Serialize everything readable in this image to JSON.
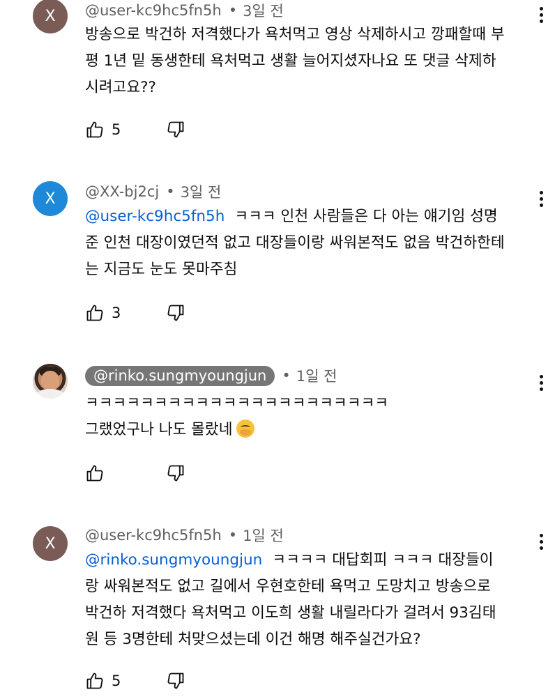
{
  "comments": [
    {
      "avatar_letter": "X",
      "author": "@user-kc9hc5fn5h",
      "time": "3일 전",
      "mention": "",
      "text": "방송으로 박건하 저격했다가 욕처먹고 영상 삭제하시고 깡패할때 부\n평 1년 밑 동생한테 욕처먹고 생활 늘어지셨자나요 또 댓글 삭제하\n시려고요??",
      "likes": "5"
    },
    {
      "avatar_letter": "X",
      "author": "@XX-bj2cj",
      "time": "3일 전",
      "mention": "@user-kc9hc5fn5h",
      "text": "ㅋㅋㅋ 인천 사람들은 다 아는 얘기임 성명\n준 인천 대장이였던적 없고 대장들이랑 싸워본적도 없음 박건하한테\n는 지금도 눈도 못마주침",
      "likes": "3"
    },
    {
      "author": "@rinko.sungmyoungjun",
      "time": "1일 전",
      "mention": "",
      "text": "ㅋㅋㅋㅋㅋㅋㅋㅋㅋㅋㅋㅋㅋㅋㅋㅋㅋㅋㅋㅋㅋㅋ\n그랬었구나 나도 몰랐네",
      "likes": ""
    },
    {
      "avatar_letter": "X",
      "author": "@user-kc9hc5fn5h",
      "time": "1일 전",
      "mention": "@rinko.sungmyoungjun",
      "text": "ㅋㅋㅋㅋ 대답회피 ㅋㅋㅋ 대장들이\n랑 싸워본적도 없고 길에서 우현호한테 욕먹고 도망치고 방송으로\n박건하 저격했다 욕처먹고 이도희 생활 내릴라다가 걸려서 93김태\n원 등 3명한테 처맞으셨는데 이건 해명 해주실건가요?",
      "likes": "5"
    }
  ],
  "separator": "•",
  "icons": {
    "like": "thumbs-up-icon",
    "dislike": "thumbs-down-icon",
    "more": "more-vert-icon",
    "emoji": "smiling-face-with-hand-over-mouth"
  },
  "colors": {
    "link": "#065fd4",
    "meta": "#606060",
    "avatar_brown": "#7a5b55",
    "avatar_blue": "#1e88d9"
  }
}
